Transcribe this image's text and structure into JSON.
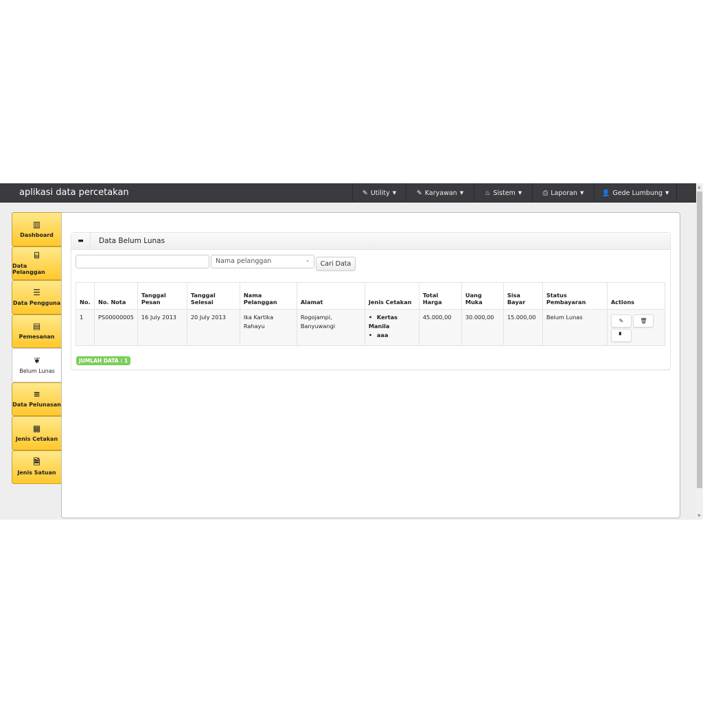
{
  "app": {
    "title": "aplikasi data percetakan"
  },
  "nav": [
    {
      "icon": "wrench-icon",
      "glyph": "✎",
      "label": "Utility"
    },
    {
      "icon": "wrench-icon",
      "glyph": "✎",
      "label": "Karyawan"
    },
    {
      "icon": "fire-icon",
      "glyph": "♨",
      "label": "Sistem"
    },
    {
      "icon": "print-icon",
      "glyph": "⎙",
      "label": "Laporan"
    },
    {
      "icon": "user-icon",
      "glyph": "👤",
      "label": "Gede Lumbung"
    }
  ],
  "sidebar": [
    {
      "label": "Dashboard",
      "glyph": "▥"
    },
    {
      "label": "Data Pelanggan",
      "glyph": "⌸"
    },
    {
      "label": "Data Pengguna",
      "glyph": "☰"
    },
    {
      "label": "Pemesanan",
      "glyph": "▤"
    },
    {
      "label": "Belum Lunas",
      "glyph": "❦"
    },
    {
      "label": "Data Pelunasan",
      "glyph": "≡"
    },
    {
      "label": "Jenis Cetakan",
      "glyph": "▦"
    },
    {
      "label": "Jenis Satuan",
      "glyph": "🗎"
    }
  ],
  "panel": {
    "title": "Data Belum Lunas",
    "search_value": "",
    "select_value": "Nama pelanggan",
    "search_button": "Cari Data",
    "count_badge": "JUMLAH DATA : 1"
  },
  "table": {
    "headers": [
      "No.",
      "No. Nota",
      "Tanggal Pesan",
      "Tanggal Selesai",
      "Nama Pelanggan",
      "Alamat",
      "Jenis Cetakan",
      "Total Harga",
      "Uang Muka",
      "Sisa Bayar",
      "Status Pembayaran",
      "Actions"
    ],
    "rows": [
      {
        "no": "1",
        "nota": "PS00000005",
        "pesan": "16 July 2013",
        "selesai": "20 July 2013",
        "nama": "Ika Kartika Rahayu",
        "alamat": "Rogojampi, Banyuwangi",
        "jenis": [
          "Kertas Manila",
          "aaa"
        ],
        "total": "45.000,00",
        "uang_muka": "30.000,00",
        "sisa": "15.000,00",
        "status": "Belum Lunas"
      }
    ]
  }
}
